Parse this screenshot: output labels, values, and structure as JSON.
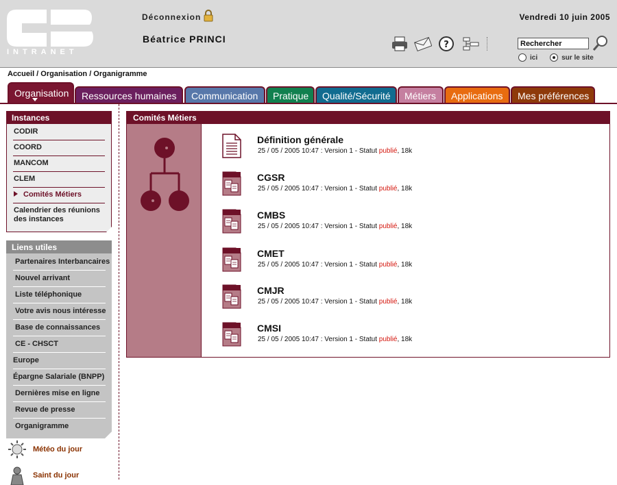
{
  "header": {
    "logo_text": "INTRANET",
    "logout_label": "Déconnexion",
    "user_name": "Béatrice PRINCI",
    "date": "Vendredi 10 juin 2005",
    "search_value": "Rechercher",
    "radio_here": "ici",
    "radio_site": "sur le site",
    "toolbar_icons": [
      "printer-icon",
      "email-icon",
      "help-icon",
      "sitemap-icon"
    ]
  },
  "breadcrumb": "Accueil / Organisation / Organigramme",
  "tabs": [
    {
      "label": "Organisation",
      "color": "#7a1631"
    },
    {
      "label": "Ressources humaines",
      "color": "#6b1f5e"
    },
    {
      "label": "Communication",
      "color": "#5878aa"
    },
    {
      "label": "Pratique",
      "color": "#11804f"
    },
    {
      "label": "Qualité/Sécurité",
      "color": "#116c90"
    },
    {
      "label": "Métiers",
      "color": "#c57fa0"
    },
    {
      "label": "Applications",
      "color": "#e86c10"
    },
    {
      "label": "Mes préférences",
      "color": "#8e3a0a"
    }
  ],
  "instances": {
    "title": "Instances",
    "items": [
      "CODIR",
      "COORD",
      "MANCOM",
      "CLEM",
      "Comités Métiers",
      "Calendrier des réunions des instances"
    ]
  },
  "liens": {
    "title": "Liens utiles",
    "items": [
      "Partenaires Interbancaires",
      "Nouvel arrivant",
      "Liste téléphonique",
      "Votre avis nous intéresse",
      "Base de connaissances",
      "CE - CHSCT",
      "Europe",
      "Épargne Salariale (BNPP)",
      "Dernières mise en ligne",
      "Revue de presse",
      "Organigramme"
    ]
  },
  "extras": [
    "Météo du jour",
    "Saint du jour"
  ],
  "content": {
    "title": "Comités Métiers",
    "documents": [
      {
        "title": "Définition générale",
        "meta": "25 / 05 / 2005 10:47 : Version 1 - Statut ",
        "status": "publié",
        "size": ", 18k",
        "icon": "text-document-icon"
      },
      {
        "title": "CGSR",
        "meta": "25 / 05 / 2005 10:47 : Version 1 - Statut ",
        "status": "publié",
        "size": ", 18k",
        "icon": "folder-documents-icon"
      },
      {
        "title": "CMBS",
        "meta": "25 / 05 / 2005 10:47 : Version 1 - Statut ",
        "status": "publié",
        "size": ", 18k",
        "icon": "folder-documents-icon"
      },
      {
        "title": "CMET",
        "meta": "25 / 05 / 2005 10:47 : Version 1 - Statut ",
        "status": "publié",
        "size": ", 18k",
        "icon": "folder-documents-icon"
      },
      {
        "title": "CMJR",
        "meta": "25 / 05 / 2005 10:47 : Version 1 - Statut ",
        "status": "publié",
        "size": ", 18k",
        "icon": "folder-documents-icon"
      },
      {
        "title": "CMSI",
        "meta": "25 / 05 / 2005 10:47 : Version 1 - Statut ",
        "status": "publié",
        "size": ", 18k",
        "icon": "folder-documents-icon"
      }
    ]
  }
}
